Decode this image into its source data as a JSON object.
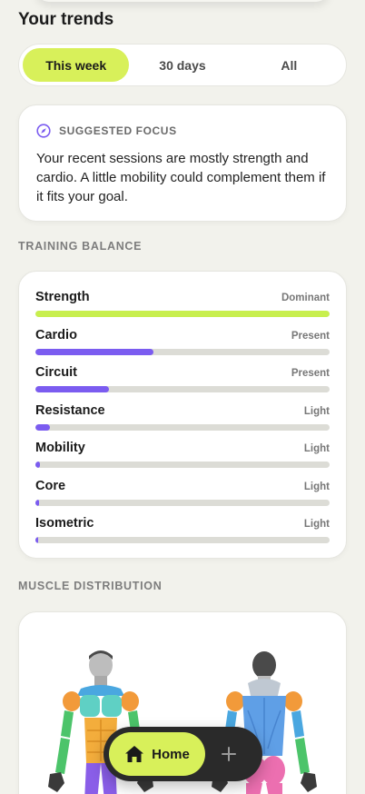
{
  "title": "Your trends",
  "tabs": [
    {
      "label": "This week",
      "active": true
    },
    {
      "label": "30 days",
      "active": false
    },
    {
      "label": "All",
      "active": false
    }
  ],
  "focus": {
    "label": "SUGGESTED FOCUS",
    "text": "Your recent sessions are mostly strength and cardio. A little mobility could complement them if it fits your goal."
  },
  "balance": {
    "section_label": "TRAINING BALANCE",
    "items": [
      {
        "name": "Strength",
        "level": "Dominant",
        "fraction": 1.0,
        "color": "#c8ef4e"
      },
      {
        "name": "Cardio",
        "level": "Present",
        "fraction": 0.4,
        "color": "#7b5cf0"
      },
      {
        "name": "Circuit",
        "level": "Present",
        "fraction": 0.25,
        "color": "#7b5cf0"
      },
      {
        "name": "Resistance",
        "level": "Light",
        "fraction": 0.05,
        "color": "#7b5cf0"
      },
      {
        "name": "Mobility",
        "level": "Light",
        "fraction": 0.015,
        "color": "#7b5cf0"
      },
      {
        "name": "Core",
        "level": "Light",
        "fraction": 0.012,
        "color": "#7b5cf0"
      },
      {
        "name": "Isometric",
        "level": "Light",
        "fraction": 0.006,
        "color": "#7b5cf0"
      }
    ]
  },
  "muscle": {
    "section_label": "MUSCLE DISTRIBUTION"
  },
  "nav": {
    "home_label": "Home",
    "home_icon": "home-icon",
    "add_icon": "plus-icon"
  },
  "colors": {
    "accent": "#d8f05a",
    "purple": "#7b5cf0"
  }
}
